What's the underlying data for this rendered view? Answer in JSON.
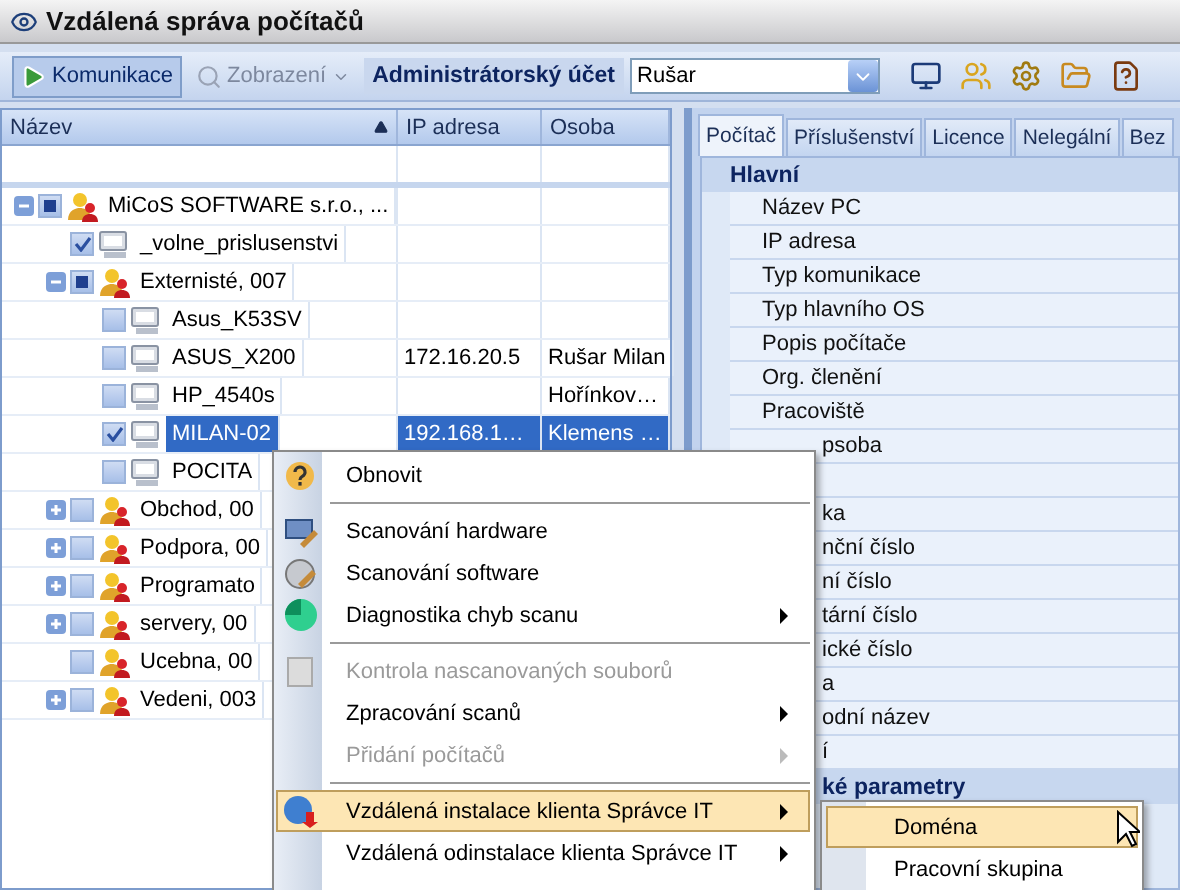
{
  "window": {
    "title": "Vzdálená správa počítačů"
  },
  "toolbar": {
    "buttons": [
      {
        "label": "Komunikace",
        "pressed": true,
        "disabled": false
      },
      {
        "label": "Zobrazení",
        "pressed": false,
        "disabled": true
      }
    ],
    "account_label": "Administrátorský účet",
    "account_combo": {
      "value": "Rušar"
    }
  },
  "tree": {
    "columns": [
      "Název",
      "IP adresa",
      "Osoba"
    ],
    "rows": [
      {
        "name": "MiCoS SOFTWARE s.r.o., ...",
        "kind": "group",
        "checked": false,
        "partial": true,
        "expanded": true,
        "selected": false,
        "children": [
          {
            "name": "_volne_prislusenstvi",
            "kind": "computer",
            "checked": true,
            "selected": false
          },
          {
            "name": "Externisté, 007",
            "kind": "group",
            "checked": false,
            "partial": true,
            "expanded": true,
            "selected": false,
            "children": [
              {
                "name": "Asus_K53SV",
                "kind": "computer",
                "checked": false,
                "selected": false
              },
              {
                "name": "ASUS_X200",
                "ip": "172.16.20.5",
                "person": "Rušar Milan",
                "kind": "computer",
                "checked": false,
                "selected": false
              },
              {
                "name": "HP_4540s",
                "person": "Hořínkov…",
                "kind": "computer",
                "checked": false,
                "selected": false
              },
              {
                "name": "MILAN-02",
                "ip": "192.168.1…",
                "person": "Klemens …",
                "kind": "computer",
                "checked": true,
                "selected": true
              },
              {
                "name": "POCITA",
                "kind": "computer",
                "checked": false,
                "selected": false
              }
            ]
          },
          {
            "name": "Obchod, 00",
            "kind": "group",
            "checked": false,
            "expanded": false,
            "selected": false
          },
          {
            "name": "Podpora, 00",
            "kind": "group",
            "checked": false,
            "expanded": false,
            "selected": false
          },
          {
            "name": "Programato",
            "kind": "group",
            "checked": false,
            "expanded": false,
            "selected": false
          },
          {
            "name": "servery, 00",
            "kind": "group",
            "checked": false,
            "expanded": false,
            "selected": false
          },
          {
            "name": "Ucebna, 00",
            "kind": "group",
            "checked": false,
            "selected": false
          },
          {
            "name": "Vedeni, 003",
            "kind": "group",
            "checked": false,
            "expanded": false,
            "selected": false
          }
        ]
      }
    ]
  },
  "detail": {
    "tabs": [
      {
        "label": "Počítač",
        "selected": true
      },
      {
        "label": "Příslušenství",
        "selected": false
      },
      {
        "label": "Licence",
        "selected": false
      },
      {
        "label": "Nelegální",
        "selected": false
      },
      {
        "label": "Bez",
        "selected": false
      }
    ],
    "sections": [
      {
        "title": "Hlavní",
        "rows": [
          {
            "label": "Název PC"
          },
          {
            "label": "IP adresa"
          },
          {
            "label": "Typ komunikace"
          },
          {
            "label": "Typ hlavního OS"
          },
          {
            "label": "Popis počítače"
          },
          {
            "label": "Org. členění"
          },
          {
            "label": "Pracoviště"
          },
          {
            "label": "psoba",
            "covered": true
          },
          {
            "kind": "blank"
          },
          {
            "label": "ka",
            "covered": true
          },
          {
            "label": "nční číslo",
            "covered": true
          },
          {
            "label": "ní číslo",
            "covered": true
          },
          {
            "label": "tární číslo",
            "covered": true
          },
          {
            "label": "ické číslo",
            "covered": true
          },
          {
            "label": "a",
            "covered": true
          },
          {
            "label": "odní název",
            "covered": true
          },
          {
            "label": "í",
            "covered": true
          }
        ]
      },
      {
        "title": "ké parametry",
        "covered": true
      }
    ]
  },
  "context_menu": {
    "items": [
      {
        "kind": "item",
        "label": "Obnovit",
        "disabled": false,
        "submenu": false,
        "selected": false
      },
      {
        "kind": "separator"
      },
      {
        "kind": "item",
        "label": "Scanování hardware",
        "disabled": false,
        "submenu": false,
        "selected": false
      },
      {
        "kind": "item",
        "label": "Scanování software",
        "disabled": false,
        "submenu": false,
        "selected": false
      },
      {
        "kind": "item",
        "label": "Diagnostika chyb scanu",
        "disabled": false,
        "submenu": true,
        "selected": false
      },
      {
        "kind": "separator"
      },
      {
        "kind": "item",
        "label": "Kontrola nascanovaných souborů",
        "disabled": true,
        "submenu": false,
        "selected": false
      },
      {
        "kind": "item",
        "label": "Zpracování scanů",
        "disabled": false,
        "submenu": true,
        "selected": false
      },
      {
        "kind": "item",
        "label": "Přidání počítačů",
        "disabled": true,
        "submenu": true,
        "selected": false
      },
      {
        "kind": "separator"
      },
      {
        "kind": "item",
        "label": "Vzdálená instalace klienta Správce IT",
        "disabled": false,
        "submenu": true,
        "selected": true
      },
      {
        "kind": "item",
        "label": "Vzdálená odinstalace klienta Správce IT",
        "disabled": false,
        "submenu": true,
        "selected": false
      }
    ],
    "submenu": [
      {
        "label": "Doména",
        "selected": true
      },
      {
        "label": "Pracovní skupina",
        "selected": false
      }
    ]
  }
}
